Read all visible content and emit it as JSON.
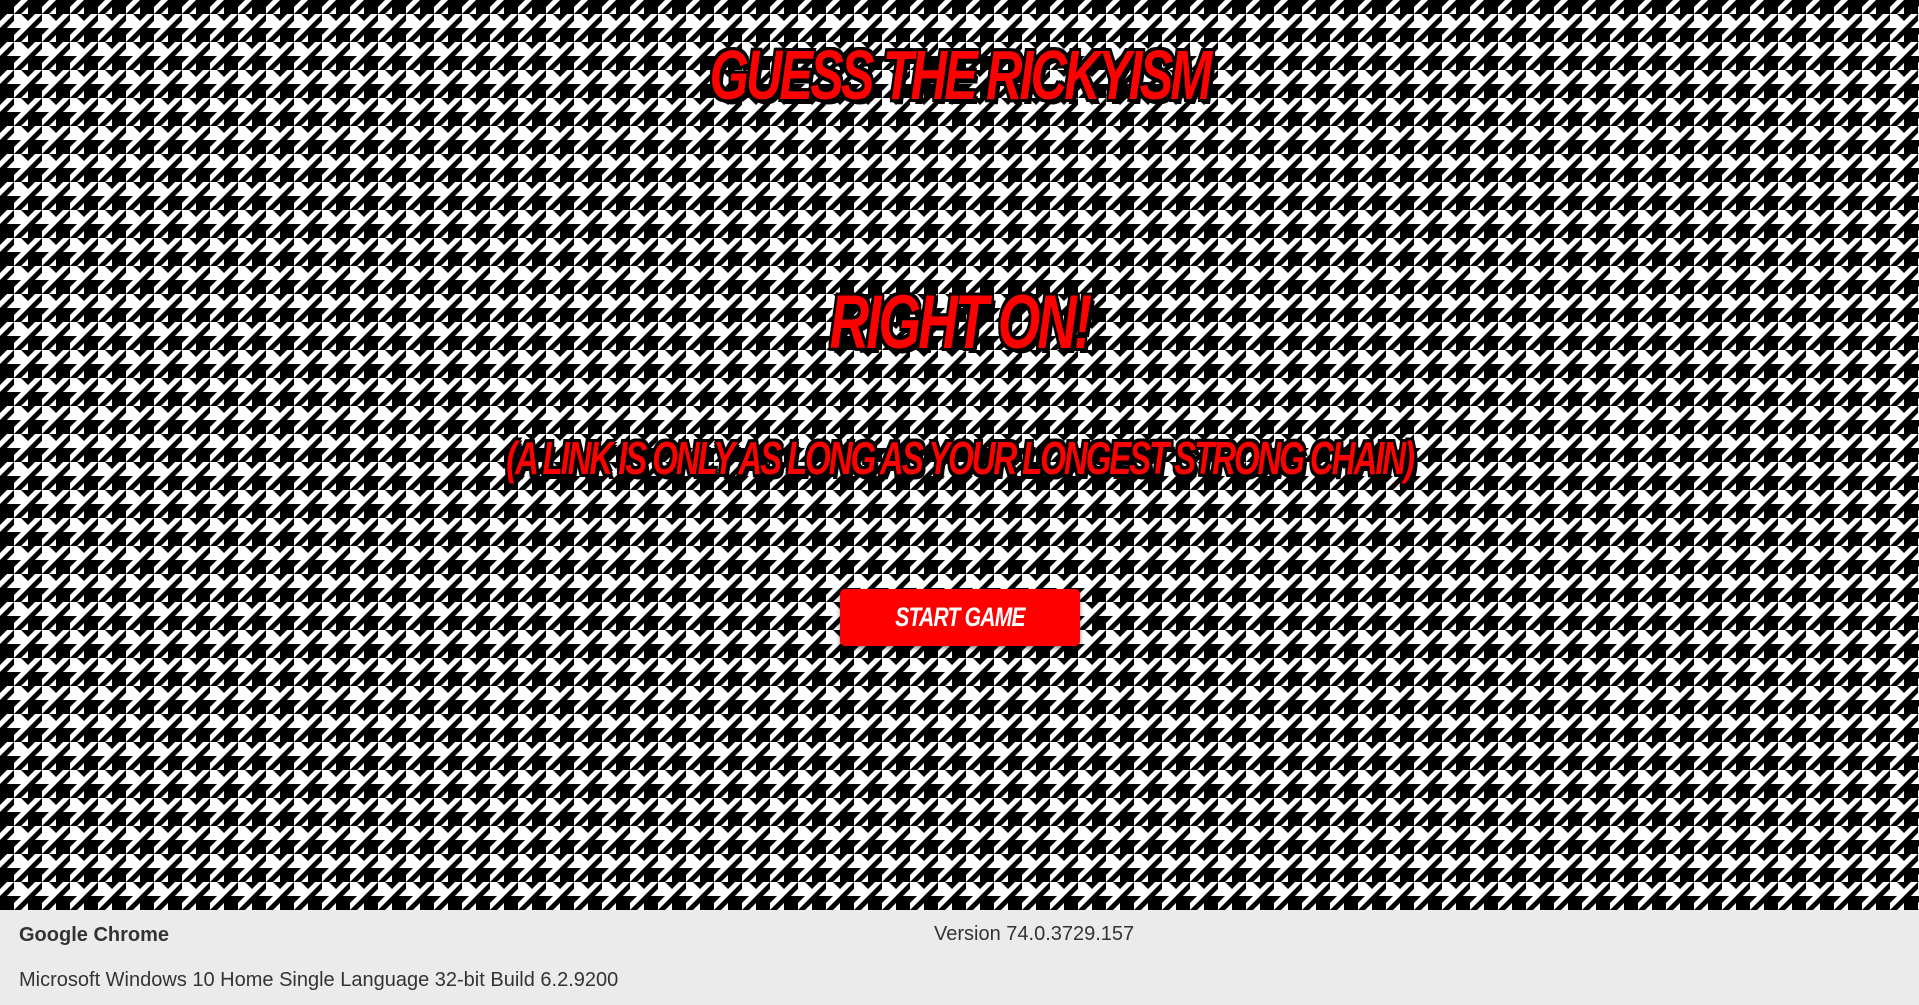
{
  "game": {
    "title": "GUESS THE RICKYISM",
    "feedback": "RIGHT ON!",
    "quote": "(A LINK IS ONLY AS LONG AS YOUR LONGEST STRONG CHAIN)",
    "start_button_label": "START GAME"
  },
  "info_bar": {
    "browser_name": "Google Chrome",
    "browser_version": "Version 74.0.3729.157",
    "os_info": "Microsoft Windows 10 Home Single Language 32-bit Build 6.2.9200"
  },
  "colors": {
    "accent_red": "#ff0000",
    "text_outline": "#000000",
    "pattern_dark": "#000000",
    "pattern_light": "#ffffff",
    "button_text": "#ffffff",
    "info_bar_bg": "#ebebeb",
    "info_bar_text": "#333333"
  },
  "background": {
    "pattern": "houndstooth"
  }
}
